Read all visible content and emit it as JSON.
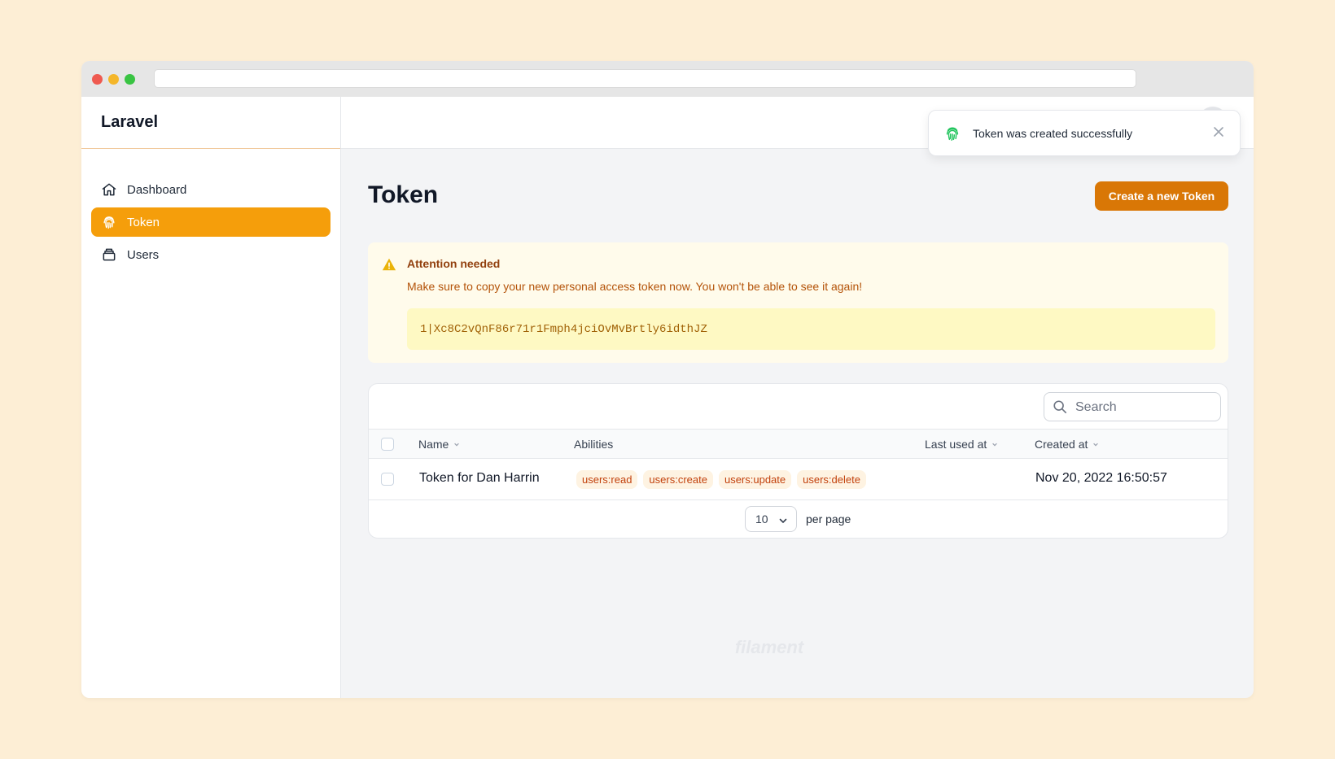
{
  "colors": {
    "background": "#fdeed5",
    "accent": "#f59e0b",
    "primary_button": "#d97706",
    "success_icon": "#22c55e",
    "warning_icon": "#eab308"
  },
  "sidebar": {
    "brand": "Laravel",
    "items": [
      {
        "label": "Dashboard",
        "icon": "home-icon",
        "active": false
      },
      {
        "label": "Token",
        "icon": "fingerprint-icon",
        "active": true
      },
      {
        "label": "Users",
        "icon": "archive-icon",
        "active": false
      }
    ]
  },
  "toast": {
    "message": "Token was created successfully",
    "icon": "fingerprint-icon"
  },
  "page": {
    "title": "Token",
    "create_button_label": "Create a new Token"
  },
  "alert": {
    "title": "Attention needed",
    "description": "Make sure to copy your new personal access token now. You won't be able to see it again!",
    "token": "1|Xc8C2vQnF86r71r1Fmph4jciOvMvBrtly6idthJZ"
  },
  "table": {
    "search_placeholder": "Search",
    "columns": {
      "name": "Name",
      "abilities": "Abilities",
      "last_used_at": "Last used at",
      "created_at": "Created at"
    },
    "rows": [
      {
        "name": "Token for Dan Harrin",
        "abilities": [
          "users:read",
          "users:create",
          "users:update",
          "users:delete"
        ],
        "last_used_at": "",
        "created_at": "Nov 20, 2022 16:50:57"
      }
    ],
    "pagination": {
      "per_page_value": "10",
      "per_page_label": "per page"
    }
  },
  "footer": {
    "logo_text": "filament"
  }
}
